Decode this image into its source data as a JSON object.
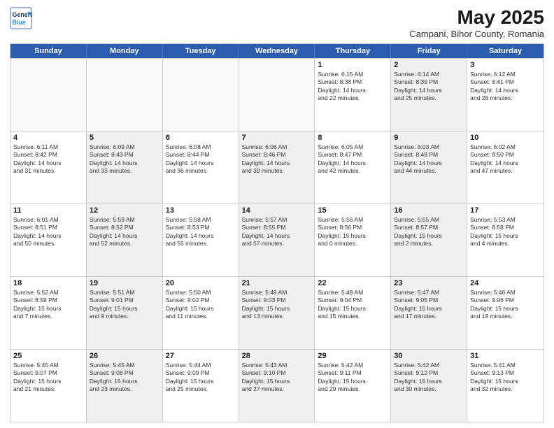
{
  "header": {
    "logo_line1": "General",
    "logo_line2": "Blue",
    "month": "May 2025",
    "location": "Campani, Bihor County, Romania"
  },
  "weekdays": [
    "Sunday",
    "Monday",
    "Tuesday",
    "Wednesday",
    "Thursday",
    "Friday",
    "Saturday"
  ],
  "rows": [
    [
      {
        "day": "",
        "text": "",
        "shaded": false,
        "empty": true
      },
      {
        "day": "",
        "text": "",
        "shaded": false,
        "empty": true
      },
      {
        "day": "",
        "text": "",
        "shaded": false,
        "empty": true
      },
      {
        "day": "",
        "text": "",
        "shaded": false,
        "empty": true
      },
      {
        "day": "1",
        "text": "Sunrise: 6:15 AM\nSunset: 8:38 PM\nDaylight: 14 hours\nand 22 minutes.",
        "shaded": false,
        "empty": false
      },
      {
        "day": "2",
        "text": "Sunrise: 6:14 AM\nSunset: 8:39 PM\nDaylight: 14 hours\nand 25 minutes.",
        "shaded": true,
        "empty": false
      },
      {
        "day": "3",
        "text": "Sunrise: 6:12 AM\nSunset: 8:41 PM\nDaylight: 14 hours\nand 28 minutes.",
        "shaded": false,
        "empty": false
      }
    ],
    [
      {
        "day": "4",
        "text": "Sunrise: 6:11 AM\nSunset: 8:42 PM\nDaylight: 14 hours\nand 31 minutes.",
        "shaded": false,
        "empty": false
      },
      {
        "day": "5",
        "text": "Sunrise: 6:09 AM\nSunset: 8:43 PM\nDaylight: 14 hours\nand 33 minutes.",
        "shaded": true,
        "empty": false
      },
      {
        "day": "6",
        "text": "Sunrise: 6:08 AM\nSunset: 8:44 PM\nDaylight: 14 hours\nand 36 minutes.",
        "shaded": false,
        "empty": false
      },
      {
        "day": "7",
        "text": "Sunrise: 6:06 AM\nSunset: 8:46 PM\nDaylight: 14 hours\nand 39 minutes.",
        "shaded": true,
        "empty": false
      },
      {
        "day": "8",
        "text": "Sunrise: 6:05 AM\nSunset: 8:47 PM\nDaylight: 14 hours\nand 42 minutes.",
        "shaded": false,
        "empty": false
      },
      {
        "day": "9",
        "text": "Sunrise: 6:03 AM\nSunset: 8:48 PM\nDaylight: 14 hours\nand 44 minutes.",
        "shaded": true,
        "empty": false
      },
      {
        "day": "10",
        "text": "Sunrise: 6:02 AM\nSunset: 8:50 PM\nDaylight: 14 hours\nand 47 minutes.",
        "shaded": false,
        "empty": false
      }
    ],
    [
      {
        "day": "11",
        "text": "Sunrise: 6:01 AM\nSunset: 8:51 PM\nDaylight: 14 hours\nand 50 minutes.",
        "shaded": false,
        "empty": false
      },
      {
        "day": "12",
        "text": "Sunrise: 5:59 AM\nSunset: 8:52 PM\nDaylight: 14 hours\nand 52 minutes.",
        "shaded": true,
        "empty": false
      },
      {
        "day": "13",
        "text": "Sunrise: 5:58 AM\nSunset: 8:53 PM\nDaylight: 14 hours\nand 55 minutes.",
        "shaded": false,
        "empty": false
      },
      {
        "day": "14",
        "text": "Sunrise: 5:57 AM\nSunset: 8:55 PM\nDaylight: 14 hours\nand 57 minutes.",
        "shaded": true,
        "empty": false
      },
      {
        "day": "15",
        "text": "Sunrise: 5:56 AM\nSunset: 8:56 PM\nDaylight: 15 hours\nand 0 minutes.",
        "shaded": false,
        "empty": false
      },
      {
        "day": "16",
        "text": "Sunrise: 5:55 AM\nSunset: 8:57 PM\nDaylight: 15 hours\nand 2 minutes.",
        "shaded": true,
        "empty": false
      },
      {
        "day": "17",
        "text": "Sunrise: 5:53 AM\nSunset: 8:58 PM\nDaylight: 15 hours\nand 4 minutes.",
        "shaded": false,
        "empty": false
      }
    ],
    [
      {
        "day": "18",
        "text": "Sunrise: 5:52 AM\nSunset: 8:59 PM\nDaylight: 15 hours\nand 7 minutes.",
        "shaded": false,
        "empty": false
      },
      {
        "day": "19",
        "text": "Sunrise: 5:51 AM\nSunset: 9:01 PM\nDaylight: 15 hours\nand 9 minutes.",
        "shaded": true,
        "empty": false
      },
      {
        "day": "20",
        "text": "Sunrise: 5:50 AM\nSunset: 9:02 PM\nDaylight: 15 hours\nand 11 minutes.",
        "shaded": false,
        "empty": false
      },
      {
        "day": "21",
        "text": "Sunrise: 5:49 AM\nSunset: 9:03 PM\nDaylight: 15 hours\nand 13 minutes.",
        "shaded": true,
        "empty": false
      },
      {
        "day": "22",
        "text": "Sunrise: 5:48 AM\nSunset: 9:04 PM\nDaylight: 15 hours\nand 15 minutes.",
        "shaded": false,
        "empty": false
      },
      {
        "day": "23",
        "text": "Sunrise: 5:47 AM\nSunset: 9:05 PM\nDaylight: 15 hours\nand 17 minutes.",
        "shaded": true,
        "empty": false
      },
      {
        "day": "24",
        "text": "Sunrise: 5:46 AM\nSunset: 9:06 PM\nDaylight: 15 hours\nand 19 minutes.",
        "shaded": false,
        "empty": false
      }
    ],
    [
      {
        "day": "25",
        "text": "Sunrise: 5:45 AM\nSunset: 9:07 PM\nDaylight: 15 hours\nand 21 minutes.",
        "shaded": false,
        "empty": false
      },
      {
        "day": "26",
        "text": "Sunrise: 5:45 AM\nSunset: 9:08 PM\nDaylight: 15 hours\nand 23 minutes.",
        "shaded": true,
        "empty": false
      },
      {
        "day": "27",
        "text": "Sunrise: 5:44 AM\nSunset: 9:09 PM\nDaylight: 15 hours\nand 25 minutes.",
        "shaded": false,
        "empty": false
      },
      {
        "day": "28",
        "text": "Sunrise: 5:43 AM\nSunset: 9:10 PM\nDaylight: 15 hours\nand 27 minutes.",
        "shaded": true,
        "empty": false
      },
      {
        "day": "29",
        "text": "Sunrise: 5:42 AM\nSunset: 9:11 PM\nDaylight: 15 hours\nand 29 minutes.",
        "shaded": false,
        "empty": false
      },
      {
        "day": "30",
        "text": "Sunrise: 5:42 AM\nSunset: 9:12 PM\nDaylight: 15 hours\nand 30 minutes.",
        "shaded": true,
        "empty": false
      },
      {
        "day": "31",
        "text": "Sunrise: 5:41 AM\nSunset: 9:13 PM\nDaylight: 15 hours\nand 32 minutes.",
        "shaded": false,
        "empty": false
      }
    ]
  ]
}
